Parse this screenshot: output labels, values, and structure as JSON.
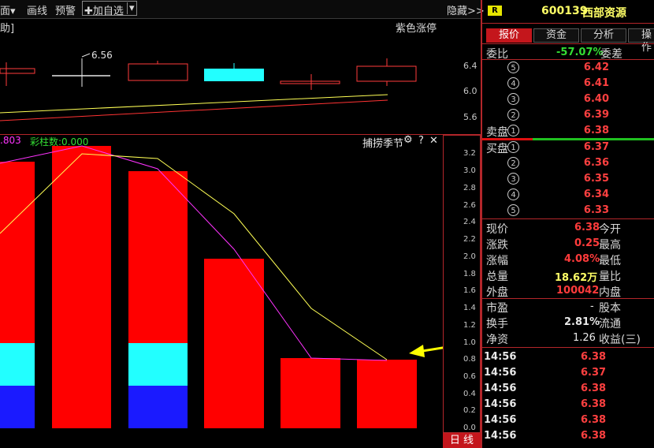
{
  "toolbar": {
    "item_face": "面▾",
    "item_draw": "画线",
    "item_alert": "预警",
    "add_watch": "✚加自选",
    "add_watch_arrow": "▾",
    "hide": "隐藏>>"
  },
  "upper_chart": {
    "left_label": "助]",
    "right_label": "紫色涨停",
    "marker": "6.56",
    "axis": [
      "6.4",
      "6.0",
      "5.6"
    ]
  },
  "indicator": {
    "value_label": ".803",
    "cai_label": "彩柱数:0.000",
    "name": "捕捞季节",
    "gear": "⚙",
    "help": "?",
    "close": "✕",
    "axis": [
      "3.2",
      "3.0",
      "2.8",
      "2.6",
      "2.4",
      "2.2",
      "2.0",
      "1.8",
      "1.6",
      "1.4",
      "1.2",
      "1.0",
      "0.8",
      "0.6",
      "0.4",
      "0.2",
      "0.0"
    ],
    "period_label": "日 线"
  },
  "stock": {
    "badge": "R",
    "code": "600139",
    "name": "西部资源"
  },
  "tabs": [
    "报价",
    "资金",
    "分析",
    "操作"
  ],
  "order_book": {
    "ratio_label": "委比",
    "ratio_value": "-57.07%",
    "diff_label": "委差",
    "sell_label": "卖盘",
    "buy_label": "买盘",
    "sells": [
      {
        "n": "5",
        "price": "6.42"
      },
      {
        "n": "4",
        "price": "6.41"
      },
      {
        "n": "3",
        "price": "6.40"
      },
      {
        "n": "2",
        "price": "6.39"
      },
      {
        "n": "1",
        "price": "6.38"
      }
    ],
    "buys": [
      {
        "n": "1",
        "price": "6.37"
      },
      {
        "n": "2",
        "price": "6.36"
      },
      {
        "n": "3",
        "price": "6.35"
      },
      {
        "n": "4",
        "price": "6.34"
      },
      {
        "n": "5",
        "price": "6.33"
      }
    ]
  },
  "quote": {
    "now_label": "现价",
    "now_value": "6.38",
    "open_label": "今开",
    "chg_label": "涨跌",
    "chg_value": "0.25",
    "high_label": "最高",
    "pct_label": "涨幅",
    "pct_value": "4.08%",
    "low_label": "最低",
    "vol_label": "总量",
    "vol_value": "18.62万",
    "ratio_label": "量比",
    "out_label": "外盘",
    "out_value": "100042",
    "in_label": "内盘",
    "pe_label": "市盈",
    "pe_value": "-",
    "equity_label": "股本",
    "turn_label": "换手",
    "turn_value": "2.81%",
    "float_label": "流通",
    "nav_label": "净资",
    "nav_value": "1.26",
    "eps_label": "收益(三)"
  },
  "ticks": [
    {
      "time": "14:56",
      "price": "6.38"
    },
    {
      "time": "14:56",
      "price": "6.37"
    },
    {
      "time": "14:56",
      "price": "6.38"
    },
    {
      "time": "14:56",
      "price": "6.38"
    },
    {
      "time": "14:56",
      "price": "6.38"
    },
    {
      "time": "14:56",
      "price": "6.38"
    }
  ],
  "colors": {
    "up": "#ff3b3b",
    "down": "#33dd33",
    "cyan": "#22ffff",
    "blue": "#1a1aff",
    "magenta": "#ff33ff",
    "yellow": "#ffff55",
    "frame": "#b3262a"
  }
}
